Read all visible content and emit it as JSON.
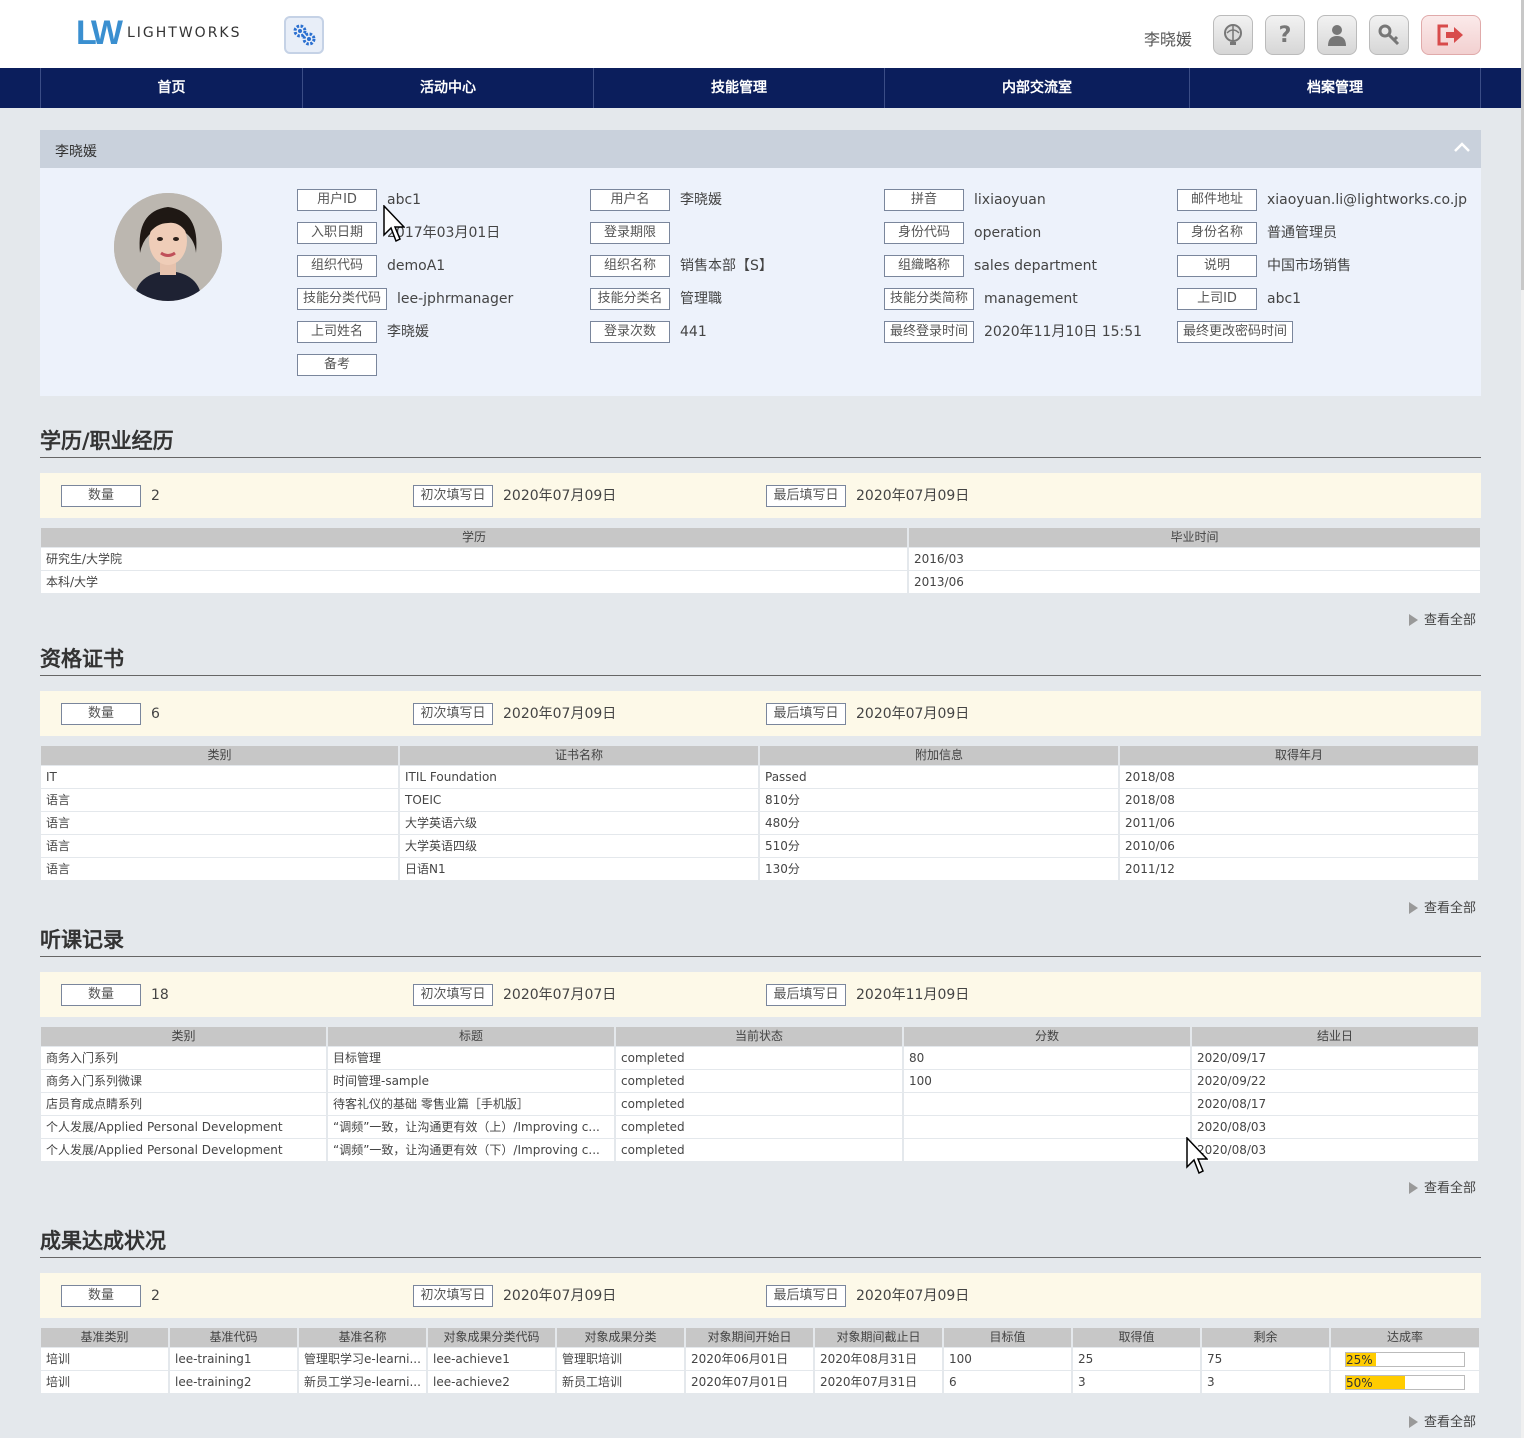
{
  "header": {
    "logo_mark": "LW",
    "logo_text": "LIGHTWORKS",
    "username": "李晓媛"
  },
  "nav": [
    "首页",
    "活动中心",
    "技能管理",
    "内部交流室",
    "档案管理"
  ],
  "profile": {
    "name": "李晓媛",
    "fields": [
      {
        "label": "用户ID",
        "value": "abc1"
      },
      {
        "label": "用户名",
        "value": "李晓媛"
      },
      {
        "label": "拼音",
        "value": "lixiaoyuan"
      },
      {
        "label": "邮件地址",
        "value": "xiaoyuan.li@lightworks.co.jp"
      },
      {
        "label": "入职日期",
        "value": "2017年03月01日"
      },
      {
        "label": "登录期限",
        "value": ""
      },
      {
        "label": "身份代码",
        "value": "operation"
      },
      {
        "label": "身份名称",
        "value": "普通管理员"
      },
      {
        "label": "组织代码",
        "value": "demoA1"
      },
      {
        "label": "组织名称",
        "value": "销售本部【S】"
      },
      {
        "label": "组織略称",
        "value": "sales department"
      },
      {
        "label": "说明",
        "value": "中国市场销售"
      },
      {
        "label": "技能分类代码",
        "value": "lee-jphrmanager"
      },
      {
        "label": "技能分类名",
        "value": "管理職"
      },
      {
        "label": "技能分类简称",
        "value": "management"
      },
      {
        "label": "上司ID",
        "value": "abc1"
      },
      {
        "label": "上司姓名",
        "value": "李晓媛"
      },
      {
        "label": "登录次数",
        "value": "441"
      },
      {
        "label": "最终登录时间",
        "value": "2020年11月10日 15:51"
      },
      {
        "label": "最终更改密码时间",
        "value": ""
      },
      {
        "label": "备考",
        "value": ""
      }
    ]
  },
  "summary_labels": {
    "count": "数量",
    "first": "初次填写日",
    "last": "最后填写日"
  },
  "view_all": "查看全部",
  "education": {
    "title": "学历/职业经历",
    "count": "2",
    "first": "2020年07月09日",
    "last": "2020年07月09日",
    "columns": [
      "学历",
      "毕业时间"
    ],
    "rows": [
      [
        "研究生/大学院",
        "2016/03"
      ],
      [
        "本科/大学",
        "2013/06"
      ]
    ]
  },
  "certificates": {
    "title": "资格证书",
    "count": "6",
    "first": "2020年07月09日",
    "last": "2020年07月09日",
    "columns": [
      "类别",
      "证书名称",
      "附加信息",
      "取得年月"
    ],
    "rows": [
      [
        "IT",
        "ITIL Foundation",
        "Passed",
        "2018/08"
      ],
      [
        "语言",
        "TOEIC",
        "810分",
        "2018/08"
      ],
      [
        "语言",
        "大学英语六级",
        "480分",
        "2011/06"
      ],
      [
        "语言",
        "大学英语四级",
        "510分",
        "2010/06"
      ],
      [
        "语言",
        "日语N1",
        "130分",
        "2011/12"
      ]
    ]
  },
  "courses": {
    "title": "听课记录",
    "count": "18",
    "first": "2020年07月07日",
    "last": "2020年11月09日",
    "columns": [
      "类别",
      "标题",
      "当前状态",
      "分数",
      "结业日"
    ],
    "rows": [
      [
        "商务入门系列",
        "目标管理",
        "completed",
        "80",
        "2020/09/17"
      ],
      [
        "商务入门系列微课",
        "时间管理-sample",
        "completed",
        "100",
        "2020/09/22"
      ],
      [
        "店员育成点睛系列",
        "待客礼仪的基础 零售业篇［手机版］",
        "completed",
        "",
        "2020/08/17"
      ],
      [
        "个人发展/Applied Personal Development",
        "“调频”一致，让沟通更有效（上）/Improving c...",
        "completed",
        "",
        "2020/08/03"
      ],
      [
        "个人发展/Applied Personal Development",
        "“调频”一致，让沟通更有效（下）/Improving c...",
        "completed",
        "",
        "2020/08/03"
      ]
    ]
  },
  "achievements": {
    "title": "成果达成状况",
    "count": "2",
    "first": "2020年07月09日",
    "last": "2020年07月09日",
    "columns": [
      "基准类别",
      "基准代码",
      "基准名称",
      "对象成果分类代码",
      "对象成果分类",
      "对象期间开始日",
      "对象期间截止日",
      "目标值",
      "取得值",
      "剩余",
      "达成率"
    ],
    "rows": [
      [
        "培训",
        "lee-training1",
        "管理职学习e-learni...",
        "lee-achieve1",
        "管理职培训",
        "2020年06月01日",
        "2020年08月31日",
        "100",
        "25",
        "75",
        "25%"
      ],
      [
        "培训",
        "lee-training2",
        "新员工学习e-learni...",
        "lee-achieve2",
        "新员工培训",
        "2020年07月01日",
        "2020年07月31日",
        "6",
        "3",
        "3",
        "50%"
      ]
    ],
    "rates": [
      0.25,
      0.5
    ]
  },
  "colors": {
    "nav_bg": "#0b1e5c",
    "rate_fill": "#ffcc00",
    "summary_bg": "#fdf9e8"
  },
  "icons": [
    "gear-icon",
    "globe-icon",
    "help-icon",
    "user-icon",
    "key-icon",
    "logout-icon",
    "chevron-up-icon",
    "triangle-right-icon"
  ]
}
